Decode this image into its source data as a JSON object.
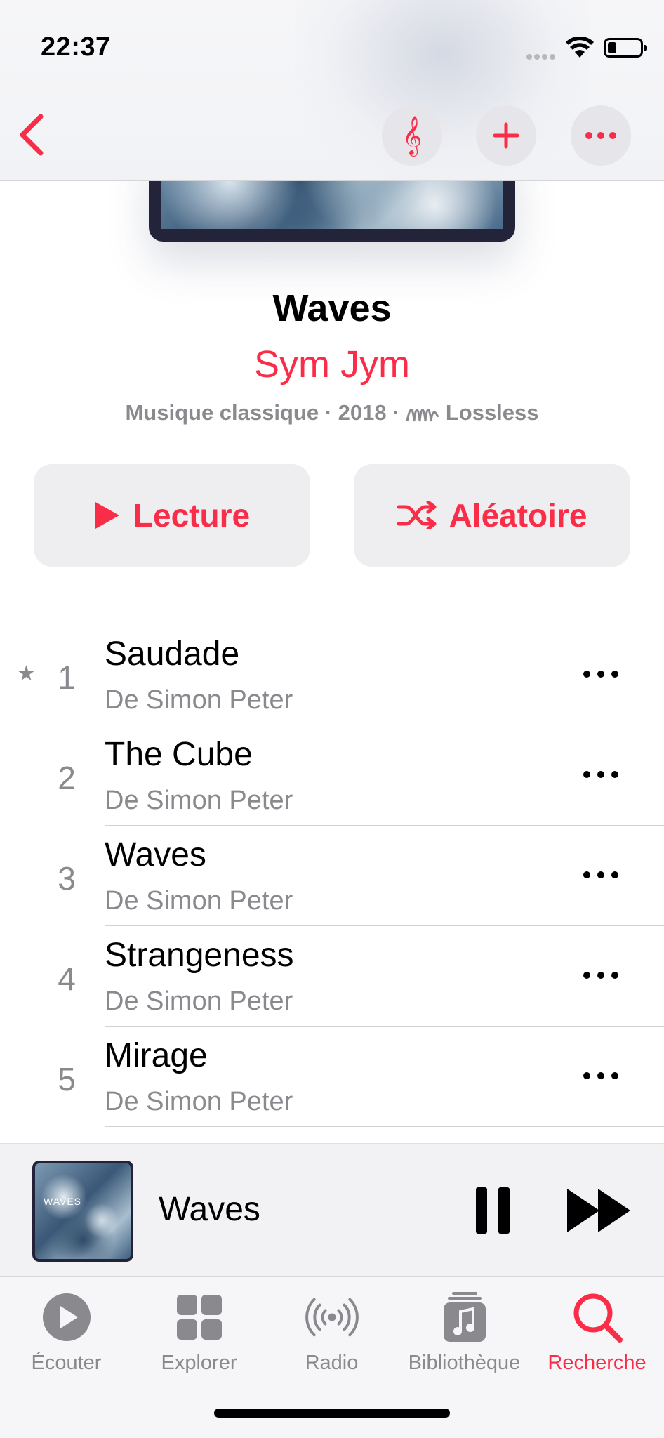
{
  "status_bar": {
    "time": "22:37"
  },
  "nav": {
    "back_icon": "chevron-left-icon",
    "actions": [
      "treble-clef-icon",
      "plus-icon",
      "ellipsis-icon"
    ]
  },
  "album": {
    "title": "Waves",
    "artist": "Sym Jym",
    "genre": "Musique classique",
    "year": "2018",
    "quality": "Lossless"
  },
  "buttons": {
    "play": "Lecture",
    "shuffle": "Aléatoire"
  },
  "tracks": [
    {
      "number": "1",
      "title": "Saudade",
      "subtitle": "De Simon Peter",
      "starred": true
    },
    {
      "number": "2",
      "title": "The Cube",
      "subtitle": "De Simon Peter",
      "starred": false
    },
    {
      "number": "3",
      "title": "Waves",
      "subtitle": "De Simon Peter",
      "starred": false
    },
    {
      "number": "4",
      "title": "Strangeness",
      "subtitle": "De Simon Peter",
      "starred": false
    },
    {
      "number": "5",
      "title": "Mirage",
      "subtitle": "De Simon Peter",
      "starred": false
    }
  ],
  "mini_player": {
    "title": "Waves",
    "artwork_text": "WAVES"
  },
  "tab_bar": {
    "tabs": [
      {
        "label": "Écouter",
        "icon": "play-circle-icon",
        "active": false
      },
      {
        "label": "Explorer",
        "icon": "grid-icon",
        "active": false
      },
      {
        "label": "Radio",
        "icon": "radio-waves-icon",
        "active": false
      },
      {
        "label": "Bibliothèque",
        "icon": "music-library-icon",
        "active": false
      },
      {
        "label": "Recherche",
        "icon": "search-icon",
        "active": true
      }
    ]
  },
  "colors": {
    "accent": "#fa2d48",
    "secondary_text": "#8a8a8e",
    "button_bg": "#eeeef0"
  }
}
